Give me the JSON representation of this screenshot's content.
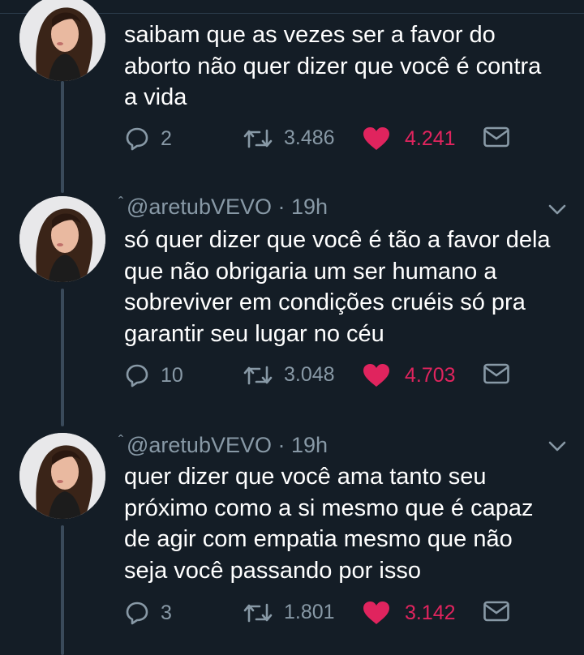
{
  "tweets": [
    {
      "text": "saibam que as vezes ser a favor do aborto não quer dizer que você é contra a vida",
      "lines": [
        "saibam que as vezes ser a favor do",
        "aborto não quer dizer que você é contra",
        "a vida"
      ],
      "replies": "2",
      "retweets": "3.486",
      "likes": "4.241"
    },
    {
      "handle": "@aretubVEVO",
      "time": "· 19h",
      "lines": [
        "só quer dizer que você é tão a favor dela",
        "que não obrigaria um ser humano a",
        "sobreviver em condições cruéis só pra",
        "garantir seu lugar no céu"
      ],
      "replies": "10",
      "retweets": "3.048",
      "likes": "4.703"
    },
    {
      "handle": "@aretubVEVO",
      "time": "· 19h",
      "lines": [
        "quer dizer que você ama tanto seu",
        "próximo como a si mesmo que é capaz",
        "de agir com empatia mesmo que não",
        "seja você passando por isso"
      ],
      "replies": "3",
      "retweets": "1.801",
      "likes": "3.142"
    }
  ],
  "colors": {
    "background": "#141d26",
    "secondary_text": "#8899a6",
    "like": "#e0245e",
    "thread_line": "#3a4a5a"
  },
  "icons": [
    "reply-icon",
    "retweet-icon",
    "heart-icon",
    "dm-icon",
    "chevron-down-icon"
  ]
}
